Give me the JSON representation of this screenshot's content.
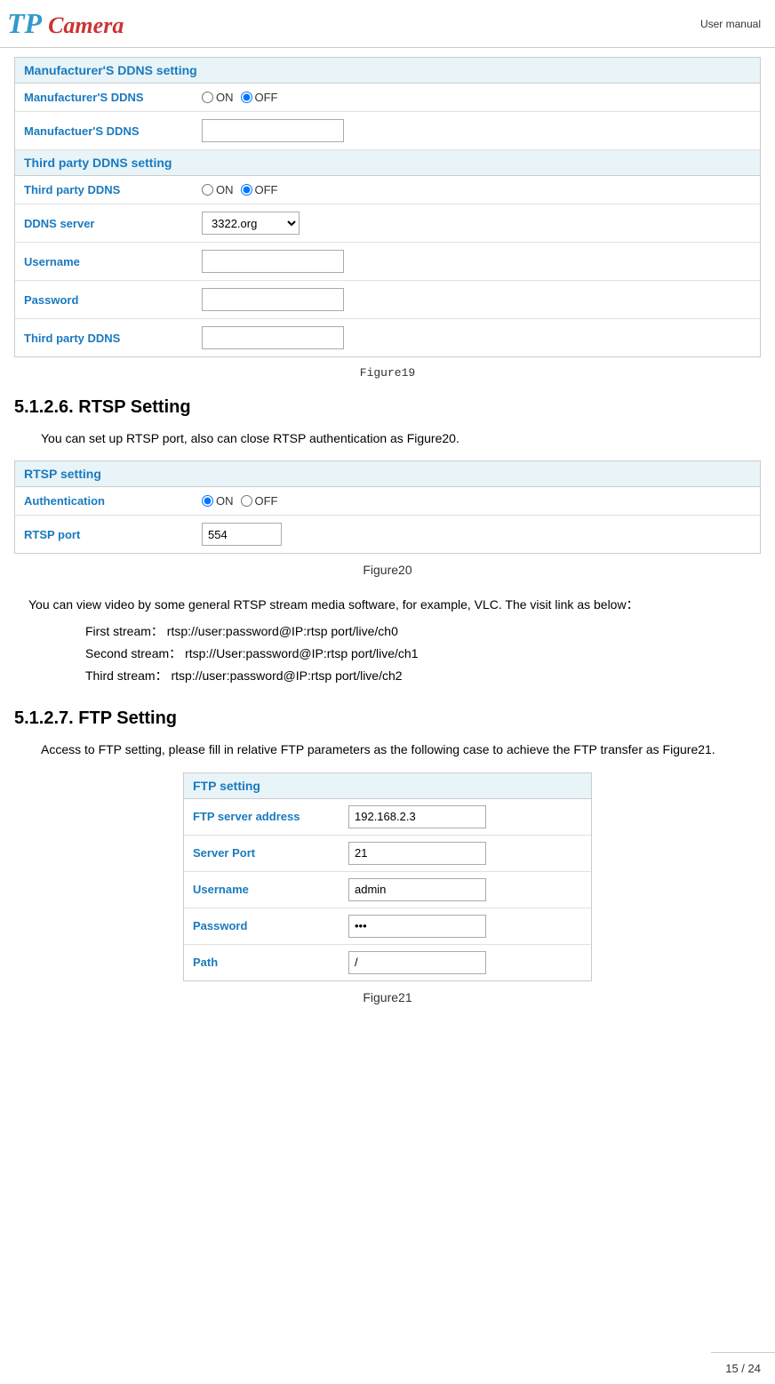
{
  "header": {
    "logo": "TP Camera",
    "logo_tp": "TP",
    "logo_camera": "Camera",
    "manual_label": "User manual"
  },
  "manufacturer_ddns": {
    "section_title": "Manufacturer'S DDNS setting",
    "fields": [
      {
        "label": "Manufacturer'S DDNS",
        "type": "radio",
        "options": [
          "ON",
          "OFF"
        ],
        "selected": "OFF"
      },
      {
        "label": "Manufactuer'S DDNS",
        "type": "text",
        "value": ""
      }
    ]
  },
  "third_party_ddns": {
    "section_title": "Third party DDNS setting",
    "fields": [
      {
        "label": "Third party DDNS",
        "type": "radio",
        "options": [
          "ON",
          "OFF"
        ],
        "selected": "OFF"
      },
      {
        "label": "DDNS server",
        "type": "select",
        "value": "3322.org",
        "options": [
          "3322.org"
        ]
      },
      {
        "label": "Username",
        "type": "text",
        "value": ""
      },
      {
        "label": "Password",
        "type": "text",
        "value": ""
      },
      {
        "label": "Third party DDNS",
        "type": "text",
        "value": ""
      }
    ]
  },
  "figure19_caption": "Figure19",
  "rtsp_section": {
    "heading": "5.1.2.6. RTSP Setting",
    "intro_text": "You can set up RTSP port, also can close RTSP authentication as Figure20.",
    "section_title": "RTSP setting",
    "fields": [
      {
        "label": "Authentication",
        "type": "radio",
        "options": [
          "ON",
          "OFF"
        ],
        "selected": "ON"
      },
      {
        "label": "RTSP port",
        "type": "text",
        "value": "554"
      }
    ],
    "figure20_caption": "Figure20",
    "description1": "You can view video by some general RTSP stream media software, for example, VLC. The visit link as below：",
    "streams": [
      {
        "label": "First stream：",
        "value": "rtsp://user:password@IP:rtsp port/live/ch0"
      },
      {
        "label": "Second stream：",
        "value": "rtsp://User:password@IP:rtsp port/live/ch1"
      },
      {
        "label": "Third stream：",
        "value": "rtsp://user:password@IP:rtsp port/live/ch2"
      }
    ]
  },
  "ftp_section": {
    "heading": "5.1.2.7. FTP Setting",
    "intro_text": "Access to FTP setting, please fill in relative FTP parameters as the following case to achieve the FTP transfer as Figure21.",
    "section_title": "FTP setting",
    "fields": [
      {
        "label": "FTP server address",
        "type": "text",
        "value": "192.168.2.3"
      },
      {
        "label": "Server Port",
        "type": "text",
        "value": "21"
      },
      {
        "label": "Username",
        "type": "text",
        "value": "admin"
      },
      {
        "label": "Password",
        "type": "password",
        "value": "•••"
      },
      {
        "label": "Path",
        "type": "text",
        "value": "/"
      }
    ],
    "figure21_caption": "Figure21"
  },
  "footer": {
    "page_info": "15 / 24"
  }
}
